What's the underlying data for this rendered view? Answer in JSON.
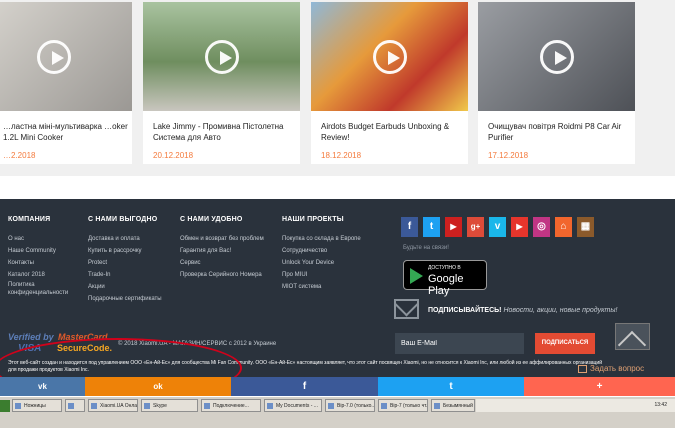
{
  "videos": [
    {
      "title": "…ластна міні-мультиварка …oker 1.2L Mini Cooker",
      "date": "…2.2018",
      "thumb_color": "#b9b7b3"
    },
    {
      "title": "Lake Jimmy - Промивна Пістолетна Система для Авто",
      "date": "20.12.2018",
      "thumb_color": "#7e9a6e"
    },
    {
      "title": "Airdots Budget Earbuds Unboxing & Review!",
      "date": "18.12.2018",
      "thumb_color": "#d96a2c"
    },
    {
      "title": "Очищувач повітря Roidmi P8 Car Air Purifier",
      "date": "17.12.2018",
      "thumb_color": "#6c6f74"
    }
  ],
  "footer": {
    "columns": [
      {
        "heading": "КОМПАНИЯ",
        "links": [
          "О нас",
          "Наше Community",
          "Контакты",
          "Каталог 2018",
          "Политика",
          "конфиденциальности"
        ]
      },
      {
        "heading": "С НАМИ ВЫГОДНО",
        "links": [
          "Доставка и оплата",
          "Купить в рассрочку",
          "Protect",
          "Trade-In",
          "Акции",
          "Подарочные сертификаты"
        ]
      },
      {
        "heading": "С НАМИ УДОБНО",
        "links": [
          "Обмен и возврат без проблем",
          "Гарантия для Вас!",
          "Сервис",
          "Проверка Серийного Номера"
        ]
      },
      {
        "heading": "НАШИ ПРОЕКТЫ",
        "links": [
          "Покупка со склада в Европе",
          "Сотрудничество",
          "Unlock Your Device",
          "Про MIUI",
          "MIOT система"
        ]
      }
    ],
    "socials": [
      {
        "name": "facebook-icon",
        "glyph": "f",
        "color": "#3b5998"
      },
      {
        "name": "twitter-icon",
        "glyph": "t",
        "color": "#1da1f2"
      },
      {
        "name": "youtube-icon",
        "glyph": "▶",
        "color": "#cd201f"
      },
      {
        "name": "google-plus-icon",
        "glyph": "g+",
        "color": "#dd4b39"
      },
      {
        "name": "vimeo-icon",
        "glyph": "v",
        "color": "#1ab7ea"
      },
      {
        "name": "video-icon",
        "glyph": "▶",
        "color": "#e6352c"
      },
      {
        "name": "instagram-icon",
        "glyph": "◎",
        "color": "#c13584"
      },
      {
        "name": "home-icon",
        "glyph": "⌂",
        "color": "#f2662d"
      },
      {
        "name": "building-icon",
        "glyph": "▦",
        "color": "#8b5a2b"
      }
    ],
    "connect_text": "Будьте на связи!",
    "google_play": {
      "small": "ДОСТУПНО В",
      "big": "Google Play"
    },
    "subscribe_title": "ПОДПИСЫВАЙТЕСЬ!",
    "subscribe_sub": "Новости, акции, новые продукты!",
    "email_placeholder": "Ваш E-Mail",
    "subscribe_button": "ПОДПИСАТЬСЯ",
    "verified_top": "Verified by",
    "verified_bottom": "VISA",
    "mastercard_top": "MasterCard.",
    "mastercard_bottom": "SecureCode.",
    "copyright": "© 2018 Xiaomi.UA - МАГАЗИН/СЕРВИС с 2012 в Украине",
    "disclaimer": "Этот веб-сайт создан и находится под управлением ООО «Ен-Ай-Ес» для сообщества Mi Fan Community. ООО «Ен-Ай-Ес» настоящим заявляет, что этот сайт посвящен Xiaomi, но не относится к Xiaomi Inc, или любой из ее аффилированных организаций для продажи продуктов Xiaomi Inc.",
    "ask_question": "Задать вопрос"
  },
  "share_bar": [
    {
      "name": "vk-share-button",
      "glyph": "vk",
      "color": "#4a76a8"
    },
    {
      "name": "ok-share-button",
      "glyph": "ok",
      "color": "#ee8208"
    },
    {
      "name": "facebook-share-button",
      "glyph": "f",
      "color": "#3b5998"
    },
    {
      "name": "twitter-share-button",
      "glyph": "t",
      "color": "#1da1f2"
    },
    {
      "name": "more-share-button",
      "glyph": "+",
      "color": "#ff6550"
    }
  ],
  "taskbar": {
    "items": [
      "Ножницы",
      "",
      "Xiaomi.UA Онла...",
      "Skype",
      "Подключение...",
      "My Documents - ...",
      "Вір-7.0 (только...",
      "Вір-7 (только чт...",
      "Безымянный - P..."
    ],
    "clock": "13:42"
  }
}
